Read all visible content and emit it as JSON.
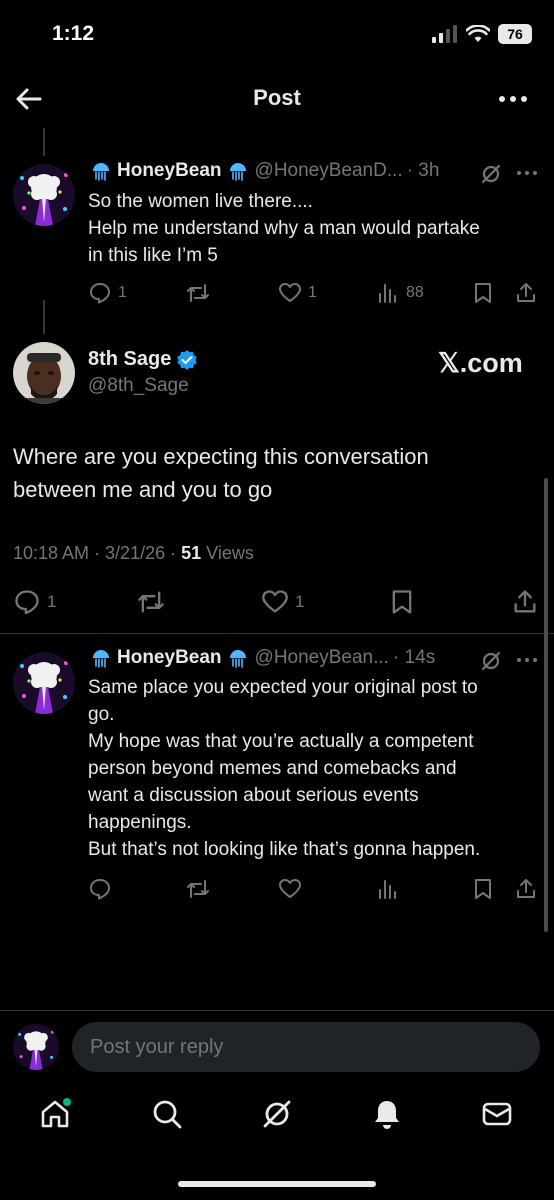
{
  "status": {
    "time": "1:12",
    "battery": "76"
  },
  "header": {
    "title": "Post"
  },
  "parent_tweet": {
    "name": "HoneyBean",
    "handle": "@HoneyBeanD...",
    "time": "· 3h",
    "lines": [
      "So the women live there....",
      "Help me understand why a man would partake",
      "in this like I’m 5"
    ],
    "replies": "1",
    "likes": "1",
    "views": "88"
  },
  "main_tweet": {
    "name": "8th Sage",
    "handle": "@8th_Sage",
    "source": "𝕏.com",
    "lines": [
      "Where are you expecting this conversation",
      "between me and you to go"
    ],
    "timestamp": "10:18 AM · 3/21/26 · ",
    "views_count": "51",
    "views_label": " Views",
    "replies": "1",
    "likes": "1"
  },
  "reply_tweet": {
    "name": "HoneyBean",
    "handle": "@HoneyBean...",
    "time": "· 14s",
    "lines": [
      "Same place you expected your original post to",
      "go.",
      "My hope was that you’re actually a competent",
      "person beyond memes and comebacks and",
      "want a discussion about serious events",
      "happenings.",
      "But that’s not looking like that’s gonna happen."
    ]
  },
  "composer": {
    "placeholder": "Post your reply"
  },
  "colors": {
    "background": "#000000",
    "text": "#e7e9ea",
    "muted": "#71767b",
    "verified": "#1d9bf0",
    "notification_dot": "#00ba7c"
  }
}
